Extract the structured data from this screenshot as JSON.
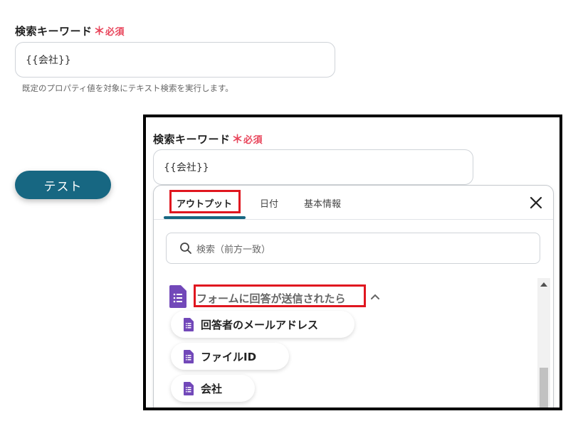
{
  "form": {
    "field_label": "検索キーワード",
    "required_mark": "＊",
    "required_text": "必須",
    "input_value": "{{会社}}",
    "helper_text": "既定のプロパティ値を対象にテキスト検索を実行します。"
  },
  "test_button_label": "テスト",
  "zoom": {
    "field_label": "検索キーワード",
    "required_mark": "＊",
    "required_text": "必須",
    "input_value": "{{会社}}",
    "tabs": [
      {
        "label": "アウトプット",
        "active": true
      },
      {
        "label": "日付",
        "active": false
      },
      {
        "label": "基本情報",
        "active": false
      }
    ],
    "search_placeholder": "検索（前方一致）",
    "group_title": "フォームに回答が送信されたら",
    "items": [
      {
        "label": "回答者のメールアドレス"
      },
      {
        "label": "ファイルID"
      },
      {
        "label": "会社"
      }
    ]
  },
  "colors": {
    "accent": "#176782",
    "required": "#e8445a",
    "highlight_box": "#e0161f",
    "form_icon": "#7248b9"
  },
  "icons": [
    "search-icon",
    "close-icon",
    "chevron-up-icon",
    "google-forms-icon"
  ]
}
